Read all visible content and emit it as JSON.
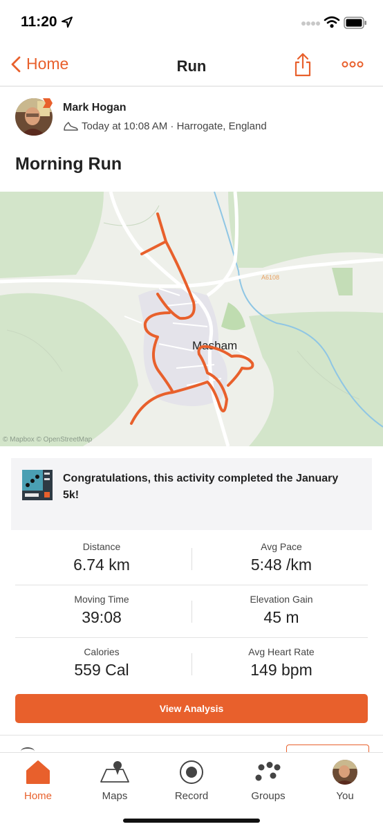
{
  "status_bar": {
    "time": "11:20"
  },
  "nav": {
    "back_label": "Home",
    "title": "Run"
  },
  "athlete": {
    "name": "Mark Hogan",
    "meta": "Today at 10:08 AM · Harrogate, England"
  },
  "activity": {
    "title": "Morning Run"
  },
  "map": {
    "place_label": "Masham",
    "road_label": "A6108",
    "attribution": "© Mapbox © OpenStreetMap"
  },
  "achievement": {
    "text": "Congratulations, this activity completed the January 5k!"
  },
  "stats": {
    "distance": {
      "label": "Distance",
      "value": "6.74 km"
    },
    "avg_pace": {
      "label": "Avg Pace",
      "value": "5:48 /km"
    },
    "moving_time": {
      "label": "Moving Time",
      "value": "39:08"
    },
    "elevation_gain": {
      "label": "Elevation Gain",
      "value": "45 m"
    },
    "calories": {
      "label": "Calories",
      "value": "559 Cal"
    },
    "avg_heart_rate": {
      "label": "Avg Heart Rate",
      "value": "149 bpm"
    }
  },
  "actions": {
    "view_analysis": "View Analysis"
  },
  "tabs": [
    {
      "label": "Home",
      "icon": "home-icon",
      "active": true
    },
    {
      "label": "Maps",
      "icon": "map-icon",
      "active": false
    },
    {
      "label": "Record",
      "icon": "record-icon",
      "active": false
    },
    {
      "label": "Groups",
      "icon": "groups-icon",
      "active": false
    },
    {
      "label": "You",
      "icon": "avatar",
      "active": false
    }
  ],
  "colors": {
    "accent": "#e8602c",
    "map_land": "#eef0ea",
    "map_green": "#cfe3c6",
    "route": "#e8602c"
  }
}
